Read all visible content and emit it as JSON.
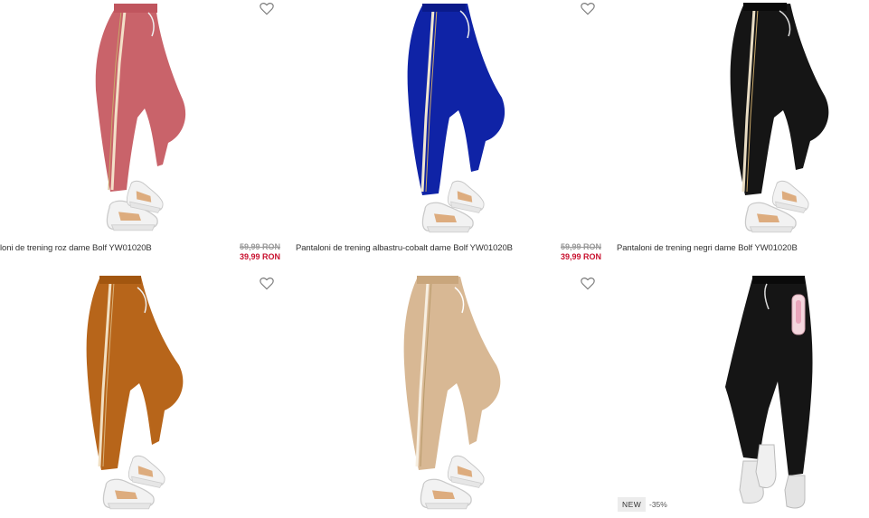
{
  "colors": {
    "pink": "#c9636a",
    "cobalt": "#0f23a6",
    "black": "#151515",
    "camel": "#b7651a",
    "beige": "#d8b894",
    "price_sale": "#c8102e",
    "price_old": "#9a9a9a"
  },
  "products": [
    {
      "title": "loni de trening roz dame Bolf YW01020B",
      "price_old": "59,99 RON",
      "price_new": "39,99 RON",
      "icon": "heart-outline-icon"
    },
    {
      "title": "Pantaloni de trening albastru-cobalt dame Bolf YW01020B",
      "price_old": "59,99 RON",
      "price_new": "39,99 RON",
      "icon": "heart-outline-icon"
    },
    {
      "title": "Pantaloni de trening negri dame Bolf YW01020B",
      "icon": "heart-outline-icon"
    },
    {
      "icon": "heart-outline-icon"
    },
    {
      "icon": "heart-outline-icon"
    },
    {
      "badge": "NEW",
      "discount": "-35%"
    }
  ]
}
